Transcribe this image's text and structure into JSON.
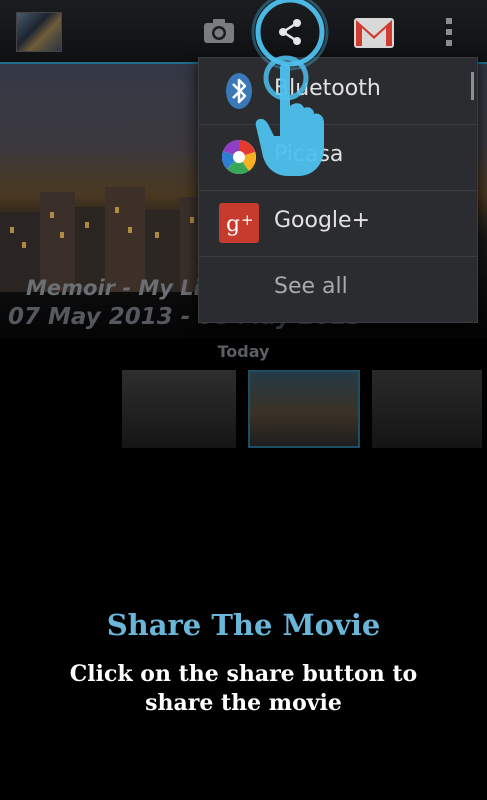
{
  "actionbar": {
    "thumbnail_icon": "movie-thumbnail-icon",
    "camera_icon": "camera-icon",
    "share_icon": "share-icon",
    "gmail_icon": "gmail-icon",
    "overflow_icon": "overflow-menu-icon"
  },
  "background": {
    "memoir_title": "Memoir - My Li",
    "memoir_dates": "07 May 2013 - 08 May 2013",
    "section_label": "Today"
  },
  "share_menu": {
    "items": [
      {
        "label": "Bluetooth",
        "icon": "bluetooth-icon"
      },
      {
        "label": "Picasa",
        "icon": "picasa-icon"
      },
      {
        "label": "Google+",
        "icon": "google-plus-icon"
      },
      {
        "label": "See all",
        "icon": ""
      }
    ]
  },
  "tutorial": {
    "title": "Share The Movie",
    "description": "Click on the share button to share the movie"
  },
  "colors": {
    "accent": "#69b6d9",
    "popup_bg": "#2a2c2f",
    "actionbar_border": "#1f6d8c"
  }
}
